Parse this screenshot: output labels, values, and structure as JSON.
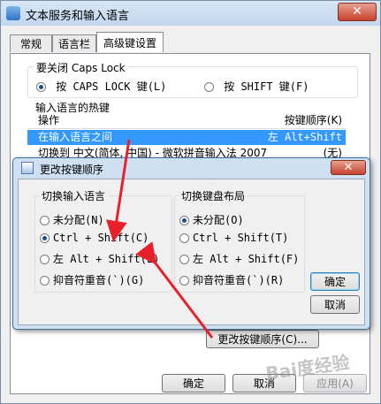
{
  "window": {
    "title": "文本服务和输入语言",
    "close_glyph": "✕"
  },
  "tabs": [
    {
      "label": "常规"
    },
    {
      "label": "语言栏"
    },
    {
      "label": "高级键设置",
      "active": true
    }
  ],
  "caps_lock": {
    "title": "要关闭 Caps Lock",
    "options": [
      {
        "label": "按 CAPS LOCK 键(L)",
        "checked": true
      },
      {
        "label": "按 SHIFT 键(F)",
        "checked": false
      }
    ]
  },
  "hotkeys": {
    "title": "输入语言的热键",
    "header_action": "操作",
    "header_sequence": "按键顺序(K)",
    "rows": [
      {
        "action": "在输入语言之间",
        "sequence": "左 Alt+Shift",
        "selected": true
      },
      {
        "action": "切换到 中文(简体, 中国) - 微软拼音输入法 2007",
        "sequence": "(无)",
        "selected": false
      }
    ],
    "change_button": "更改按键顺序(C)..."
  },
  "buttons": {
    "ok": "确定",
    "cancel": "取消",
    "apply": "应用(A)"
  },
  "dialog": {
    "title": "更改按键顺序",
    "close_glyph": "✕",
    "switch_language": {
      "title": "切换输入语言",
      "options": [
        {
          "label": "未分配(N)",
          "checked": false
        },
        {
          "label": "Ctrl + Shift(C)",
          "checked": true
        },
        {
          "label": "左 Alt + Shift(L)",
          "checked": false
        },
        {
          "label": "抑音符重音(`)(G)",
          "checked": false
        }
      ]
    },
    "switch_layout": {
      "title": "切换键盘布局",
      "options": [
        {
          "label": "未分配(O)",
          "checked": true
        },
        {
          "label": "Ctrl + Shift(T)",
          "checked": false
        },
        {
          "label": "左 Alt + Shift(F)",
          "checked": false
        },
        {
          "label": "抑音符重音(`)(R)",
          "checked": false
        }
      ]
    },
    "ok": "确定",
    "cancel": "取消"
  },
  "watermark": "Bai度经验",
  "colors": {
    "arrow": "#e8202a",
    "selection": "#3399ff",
    "dialog_frame": "#cfe0f3"
  }
}
